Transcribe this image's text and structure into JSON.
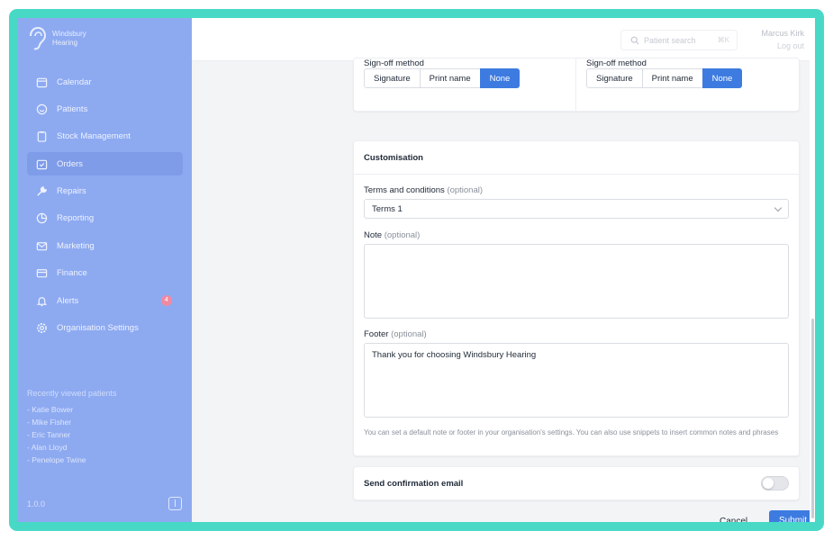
{
  "brand": {
    "line1": "Windsbury",
    "line2": "Hearing"
  },
  "sidebar": {
    "items": [
      {
        "label": "Calendar",
        "icon": "calendar-icon"
      },
      {
        "label": "Patients",
        "icon": "smile-icon"
      },
      {
        "label": "Stock Management",
        "icon": "clipboard-icon"
      },
      {
        "label": "Orders",
        "icon": "orders-icon",
        "active": true
      },
      {
        "label": "Repairs",
        "icon": "wrench-icon"
      },
      {
        "label": "Reporting",
        "icon": "pie-chart-icon"
      },
      {
        "label": "Marketing",
        "icon": "mail-icon"
      },
      {
        "label": "Finance",
        "icon": "credit-card-icon"
      },
      {
        "label": "Alerts",
        "icon": "bell-icon",
        "badge": "4"
      },
      {
        "label": "Organisation Settings",
        "icon": "gear-icon"
      }
    ],
    "recent_title": "Recently viewed patients",
    "recent": [
      "- Katie Bower",
      "- Mike Fisher",
      "- Eric Tanner",
      "- Alan Lloyd",
      "- Penelope Twine"
    ],
    "version": "1.0.0"
  },
  "topbar": {
    "search_placeholder": "Patient search",
    "search_shortcut": "⌘K",
    "user_name": "Marcus Kirk",
    "logout": "Log out"
  },
  "signoff": {
    "label": "Sign-off method",
    "options": [
      "Signature",
      "Print name",
      "None"
    ],
    "selected_left": "None",
    "selected_right": "None"
  },
  "customisation": {
    "title": "Customisation",
    "terms_label": "Terms and conditions",
    "optional": "(optional)",
    "terms_value": "Terms 1",
    "note_label": "Note",
    "note_value": "",
    "footer_label": "Footer",
    "footer_value": "Thank you for choosing Windsbury Hearing",
    "help_text": "You can set a default note or footer in your organisation's settings. You can also use snippets to insert common notes and phrases"
  },
  "email": {
    "label": "Send confirmation email",
    "enabled": false
  },
  "actions": {
    "cancel": "Cancel",
    "submit": "Submit"
  },
  "colors": {
    "accent": "#3d7be0",
    "sidebar": "#8daaf1",
    "frame": "#47d9c6",
    "badge": "#f08aa1"
  }
}
